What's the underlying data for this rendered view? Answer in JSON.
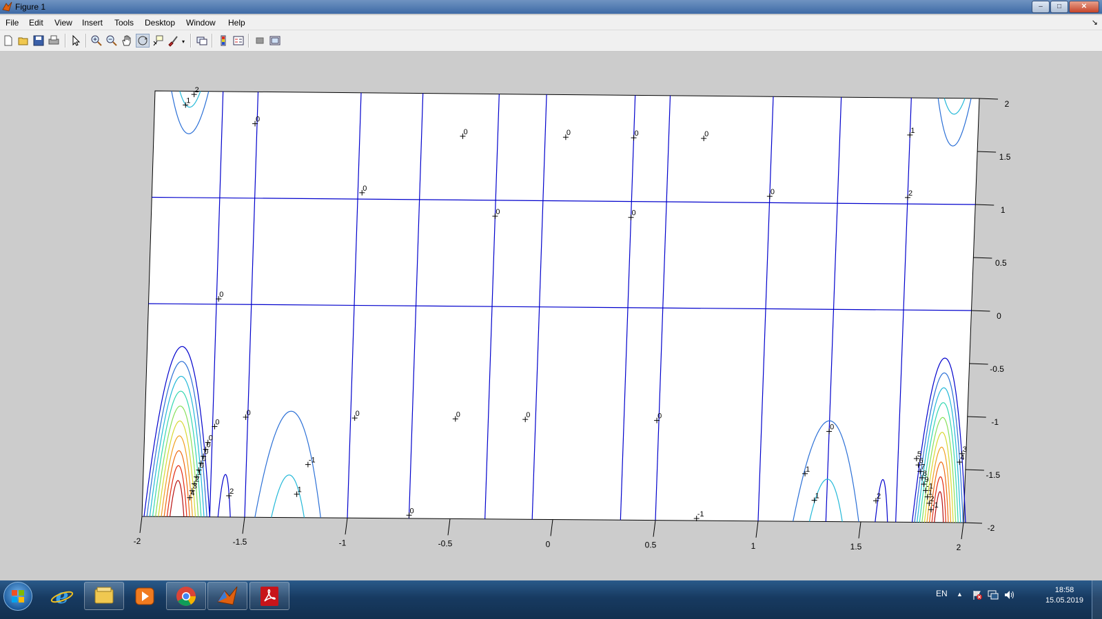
{
  "window": {
    "title": "Figure 1",
    "controls": [
      "–",
      "□",
      "✕"
    ]
  },
  "menu": {
    "items": [
      "File",
      "Edit",
      "View",
      "Insert",
      "Tools",
      "Desktop",
      "Window",
      "Help"
    ]
  },
  "toolbar": {
    "icons": [
      "new-figure-icon",
      "open-file-icon",
      "save-icon",
      "print-icon",
      "edit-plot-arrow-icon",
      "zoom-in-icon",
      "zoom-out-icon",
      "pan-hand-icon",
      "rotate-3d-icon",
      "data-cursor-icon",
      "brush-icon",
      "link-plot-icon",
      "insert-colorbar-icon",
      "insert-legend-icon",
      "hide-plot-tools-icon",
      "show-plot-tools-icon"
    ]
  },
  "plot": {
    "x_ticks": [
      "-2",
      "-1.5",
      "-1",
      "-0.5",
      "0",
      "0.5",
      "1",
      "1.5",
      "2"
    ],
    "y_ticks": [
      "2",
      "1.5",
      "1",
      "0.5",
      "0",
      "-0.5",
      "-1",
      "-1.5",
      "-2"
    ],
    "contour_labels": [
      "2",
      "1",
      "0",
      "0",
      "0",
      "0",
      "0",
      "0",
      "0",
      "0",
      "1",
      "2",
      "0",
      "0",
      "0",
      "0",
      "0",
      "0",
      "0",
      "0",
      "0",
      "0",
      "0",
      "0",
      "0",
      "0",
      "1",
      "2",
      "3",
      "4",
      "5",
      "6",
      "7",
      "8",
      "9",
      "-1",
      "1",
      "2",
      "-1",
      "-1",
      "1",
      "2",
      "0",
      "-1",
      "1",
      "1",
      "2",
      "3",
      "4",
      "5",
      "6",
      "7",
      "8",
      "9"
    ],
    "contour_colors": [
      "#0000cc",
      "#2a6fd6",
      "#22b8d8",
      "#32d7b0",
      "#86e05a",
      "#d8d830",
      "#f0a020",
      "#ee6a10",
      "#e22a10",
      "#b81010"
    ]
  },
  "taskbar": {
    "apps": [
      "internet-explorer-icon",
      "file-explorer-icon",
      "media-player-icon",
      "chrome-icon",
      "matlab-icon",
      "pdf-reader-icon"
    ],
    "language": "EN",
    "time": "18:58",
    "date": "15.05.2019"
  }
}
